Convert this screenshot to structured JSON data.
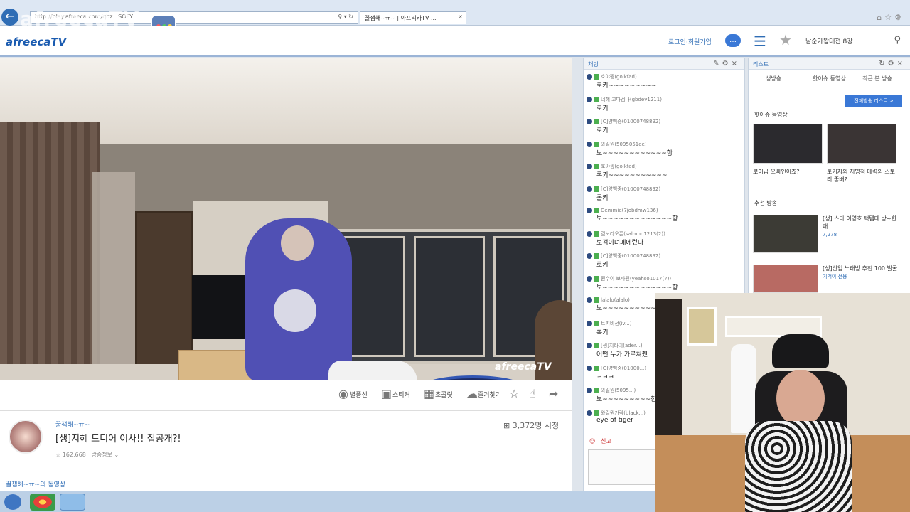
{
  "browser": {
    "address": "http://play.afreeca.com/qbz...SOFY...",
    "tab_title": "꿀잼해~ㅠ~ | 아프리카TV ...",
    "watermark": "afreecaTV"
  },
  "header": {
    "logo": "afreecaTV",
    "login_label": "로그인·회원가입",
    "search_value": "남순가왕대전 8강"
  },
  "video": {
    "logo": "afreecaTV"
  },
  "video_toolbar": {
    "items": [
      "별풍선",
      "스티커",
      "초콜릿",
      "즐겨찾기"
    ]
  },
  "stream": {
    "streamer": "꿀잼해~ㅠ~",
    "title": "[생]지혜 드디어 이사!! 집공개?!",
    "fans": "162,668",
    "viewers": "3,372명 시청",
    "fan_label": "방송정보",
    "bottom_link": "꿀잼해~ㅠ~의 동영상"
  },
  "chat": {
    "header": "채팅",
    "messages": [
      {
        "who": "호야짱(goikfad)",
        "text": "로키~~~~~~~~~"
      },
      {
        "who": "너혜 고다검나(gbdev1211)",
        "text": "로키"
      },
      {
        "who": "[C]양백중(01000748892)",
        "text": "로키"
      },
      {
        "who": "와길뭔(5095051ee)",
        "text": "보~~~~~~~~~~~~항"
      },
      {
        "who": "호야짱(goikfad)",
        "text": "록키~~~~~~~~~~~"
      },
      {
        "who": "[C]양백중(01000748892)",
        "text": "롤키"
      },
      {
        "who": "Gemmie(7jobdmw136)",
        "text": "보~~~~~~~~~~~~~항"
      },
      {
        "who": "김보라오픈(salmon1213(2))",
        "text": "보검이녀페에렀다"
      },
      {
        "who": "[C]양백중(01000748892)",
        "text": "로키"
      },
      {
        "who": "뭔수이 보파원(yeahso1017(7))",
        "text": "보~~~~~~~~~~~~~항"
      },
      {
        "who": "lalalo(alalo)",
        "text": "보~~~~~~~~~~~~~~항"
      },
      {
        "who": "트키비선(iv...)",
        "text": "록키"
      },
      {
        "who": "[생]지라이(ader...)",
        "text": "어떤 누가 가르쳐줬"
      },
      {
        "who": "[C]양백중(01000...)",
        "text": "ㅋㅋㅋ"
      },
      {
        "who": "와길뭔(5095...)",
        "text": "보~~~~~~~~~항"
      },
      {
        "who": "와길뭔가락(black...)",
        "text": "eye of tiger"
      }
    ],
    "tool_label": "신고"
  },
  "list_panel": {
    "header": "리스트",
    "tabs": [
      "생방송",
      "핫이슈 동영상",
      "최근 본 방송"
    ],
    "button": "전체방송 리스트 >",
    "section1": "핫이슈 동영상",
    "cap1": "로이급 오빠인이죠?",
    "cap2": "토기자의 저명적 매력의 스토리 좋배?",
    "section2": "추천 방송",
    "rec1_title": "[생] 스타 이영호 택템대 방~한쾌",
    "rec1_meta": "7,278",
    "rec2_title": "[생]산업 노래방 추천 100 발굴",
    "rec2_meta": "기백이 전용"
  }
}
